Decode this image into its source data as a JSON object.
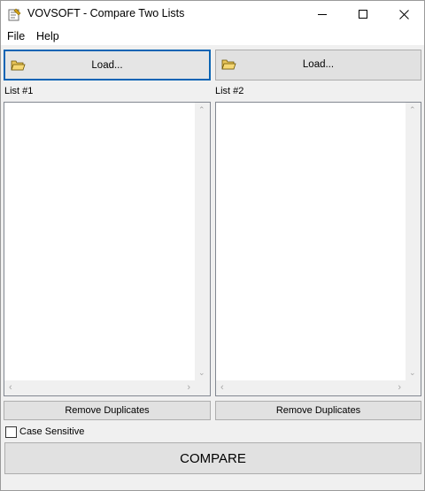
{
  "window": {
    "title": "VOVSOFT - Compare Two Lists"
  },
  "menu": {
    "file": "File",
    "help": "Help"
  },
  "panels": [
    {
      "load_label": "Load...",
      "list_label": "List #1",
      "remove_duplicates_label": "Remove Duplicates",
      "items": []
    },
    {
      "load_label": "Load...",
      "list_label": "List #2",
      "remove_duplicates_label": "Remove Duplicates",
      "items": []
    }
  ],
  "options": {
    "case_sensitive_label": "Case Sensitive",
    "case_sensitive_checked": false
  },
  "compare": {
    "label": "COMPARE"
  },
  "icons": {
    "app": "app-icon",
    "minimize": "minimize-icon",
    "maximize": "maximize-icon",
    "close": "close-icon",
    "load": "open-folder-icon"
  },
  "colors": {
    "focus_border": "#0a64b4",
    "button_face": "#e1e1e1",
    "window_bg": "#f0f0f0"
  }
}
